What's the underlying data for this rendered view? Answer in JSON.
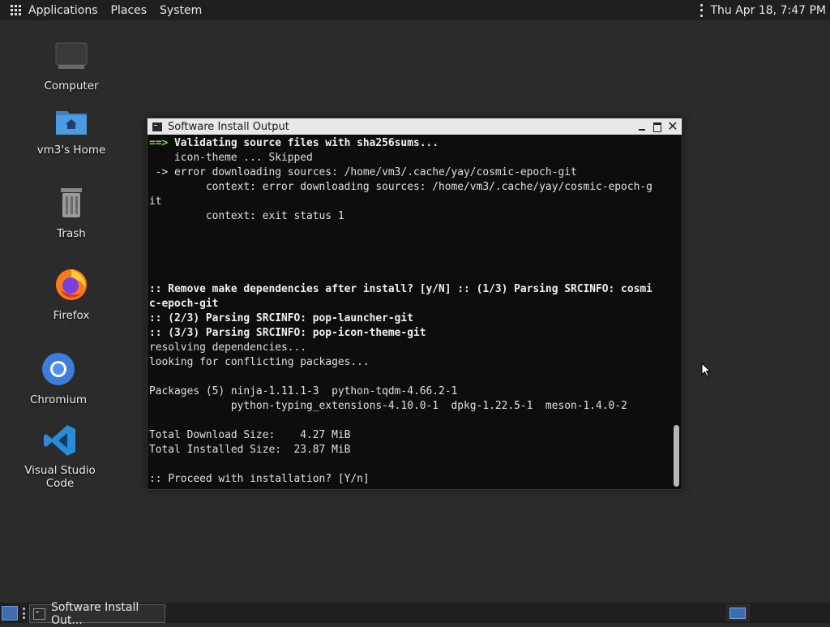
{
  "top_panel": {
    "menus": [
      "Applications",
      "Places",
      "System"
    ],
    "clock": "Thu Apr 18,  7:47 PM"
  },
  "desktop_icons": [
    {
      "label": "Computer",
      "icon": "computer-icon"
    },
    {
      "label": "vm3's Home",
      "icon": "home-folder-icon"
    },
    {
      "label": "Trash",
      "icon": "trash-icon"
    },
    {
      "label": "Firefox",
      "icon": "firefox-icon"
    },
    {
      "label": "Chromium",
      "icon": "chromium-icon"
    },
    {
      "label": "Visual Studio Code",
      "icon": "vscode-icon"
    }
  ],
  "window": {
    "title": "Software Install Output",
    "lines": [
      {
        "segs": [
          {
            "t": "==> ",
            "c": "g"
          },
          {
            "t": "Validating source files with sha256sums...",
            "c": "b"
          }
        ]
      },
      {
        "segs": [
          {
            "t": "    icon-theme ... Skipped",
            "c": ""
          }
        ]
      },
      {
        "segs": [
          {
            "t": " -> error downloading sources: /home/vm3/.cache/yay/cosmic-epoch-git",
            "c": ""
          }
        ]
      },
      {
        "segs": [
          {
            "t": "         context: error downloading sources: /home/vm3/.cache/yay/cosmic-epoch-g",
            "c": ""
          }
        ]
      },
      {
        "segs": [
          {
            "t": "it",
            "c": ""
          }
        ]
      },
      {
        "segs": [
          {
            "t": "         context: exit status 1",
            "c": ""
          }
        ]
      },
      {
        "segs": []
      },
      {
        "segs": []
      },
      {
        "segs": []
      },
      {
        "segs": []
      },
      {
        "segs": [
          {
            "t": ":: Remove make dependencies after install? [y/N] :: (1/3) Parsing SRCINFO: cosmi",
            "c": "b"
          }
        ]
      },
      {
        "segs": [
          {
            "t": "c-epoch-git",
            "c": "b"
          }
        ]
      },
      {
        "segs": [
          {
            "t": ":: (2/3) Parsing SRCINFO: pop-launcher-git",
            "c": "b"
          }
        ]
      },
      {
        "segs": [
          {
            "t": ":: (3/3) Parsing SRCINFO: pop-icon-theme-git",
            "c": "b"
          }
        ]
      },
      {
        "segs": [
          {
            "t": "resolving dependencies...",
            "c": ""
          }
        ]
      },
      {
        "segs": [
          {
            "t": "looking for conflicting packages...",
            "c": ""
          }
        ]
      },
      {
        "segs": []
      },
      {
        "segs": [
          {
            "t": "Packages (5) ninja-1.11.1-3  python-tqdm-4.66.2-1",
            "c": ""
          }
        ]
      },
      {
        "segs": [
          {
            "t": "             python-typing_extensions-4.10.0-1  dpkg-1.22.5-1  meson-1.4.0-2",
            "c": ""
          }
        ]
      },
      {
        "segs": []
      },
      {
        "segs": [
          {
            "t": "Total Download Size:    4.27 MiB",
            "c": ""
          }
        ]
      },
      {
        "segs": [
          {
            "t": "Total Installed Size:  23.87 MiB",
            "c": ""
          }
        ]
      },
      {
        "segs": []
      },
      {
        "segs": [
          {
            "t": ":: Proceed with installation? [Y/n]",
            "c": ""
          }
        ]
      }
    ]
  },
  "taskbar": {
    "task_label": "Software Install Out..."
  }
}
